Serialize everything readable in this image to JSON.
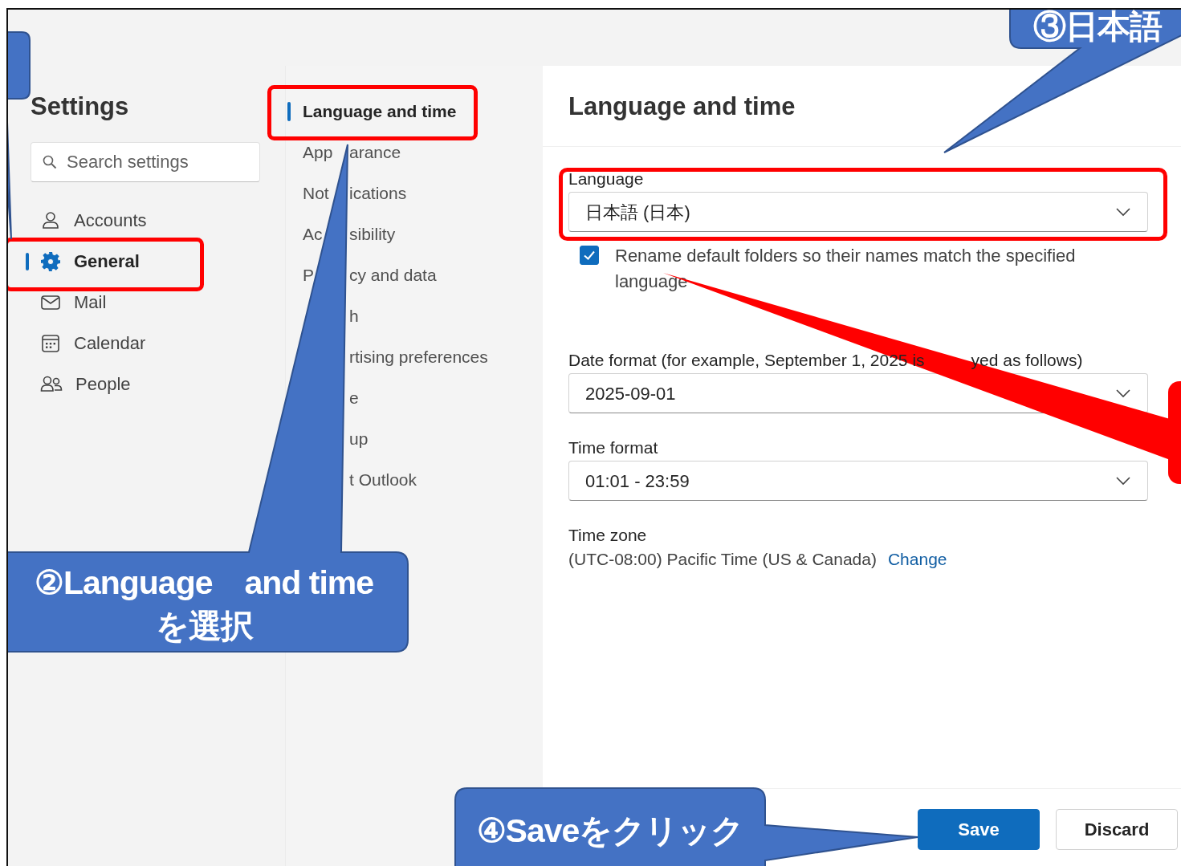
{
  "settings_title": "Settings",
  "search": {
    "placeholder": "Search settings"
  },
  "categories": [
    {
      "label": "Accounts",
      "selected": false
    },
    {
      "label": "General",
      "selected": true
    },
    {
      "label": "Mail",
      "selected": false
    },
    {
      "label": "Calendar",
      "selected": false
    },
    {
      "label": "People",
      "selected": false
    }
  ],
  "subcategories": [
    {
      "label": "Language and time",
      "selected": true
    },
    {
      "lead": "App",
      "label": "arance",
      "selected": false
    },
    {
      "lead": "Not",
      "label": "ications",
      "selected": false
    },
    {
      "lead": "Ac",
      "label": "sibility",
      "selected": false
    },
    {
      "lead": "P",
      "label": "cy and data",
      "selected": false
    },
    {
      "label": "h",
      "selected": false
    },
    {
      "label": "rtising preferences",
      "selected": false
    },
    {
      "label": "e",
      "selected": false
    },
    {
      "label": "up",
      "selected": false
    },
    {
      "label": "t Outlook",
      "selected": false
    }
  ],
  "panel": {
    "title": "Language and time",
    "fields": [
      {
        "kind": "select",
        "label": "Language",
        "value": "日本語 (日本)"
      },
      {
        "kind": "checkbox",
        "label": "Rename default folders so their names match the specified language",
        "checked": true
      },
      {
        "kind": "select",
        "label": "Date format (for example, September 1, 2025 is",
        "label_tail": "yed as follows)",
        "value": "2025-09-01"
      },
      {
        "kind": "select",
        "label": "Time format",
        "value": "01:01 - 23:59"
      },
      {
        "kind": "info",
        "label": "Time zone",
        "value": "(UTC-08:00) Pacific Time (US & Canada)",
        "link": "Change"
      }
    ],
    "buttons": [
      {
        "label": "Save",
        "kind": "primary"
      },
      {
        "label": "Discard",
        "kind": "secondary"
      }
    ]
  },
  "annotations": [
    {
      "kind": "callout"
    },
    {
      "kind": "callout",
      "text": "②Language　and time\nを選択"
    },
    {
      "kind": "callout",
      "text": "③日本語"
    },
    {
      "kind": "callout",
      "text": "④Saveをクリック"
    }
  ]
}
